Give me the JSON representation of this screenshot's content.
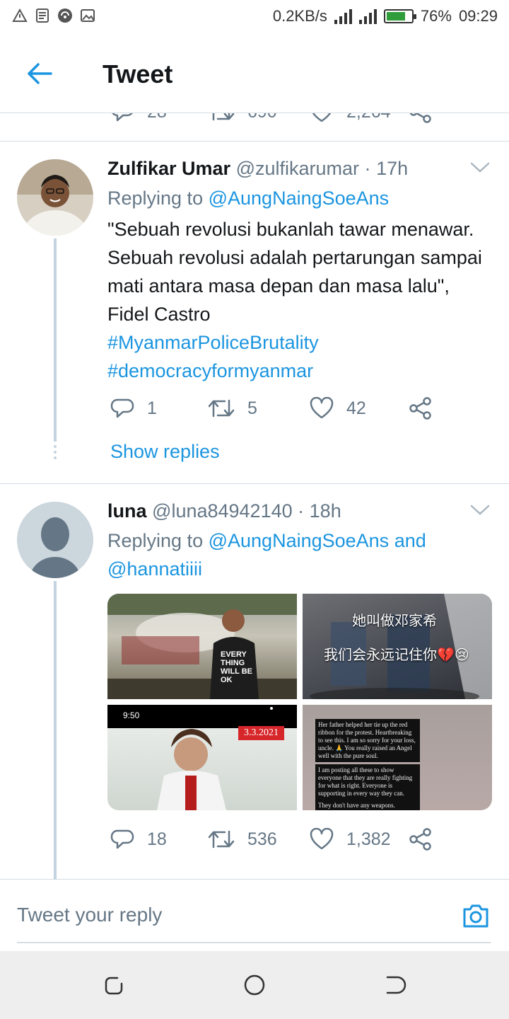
{
  "status_bar": {
    "net_speed": "0.2KB/s",
    "battery": "76%",
    "battery_level": 0.76,
    "time": "09:29"
  },
  "header": {
    "title": "Tweet"
  },
  "previous_tweet_actions": {
    "replies": "28",
    "retweets": "690",
    "likes": "2,264"
  },
  "tweets": [
    {
      "name": "Zulfikar Umar",
      "handle": "@zulfikarumar",
      "dot": "·",
      "time": "17h",
      "replying_prefix": "Replying to",
      "replying_to": "@AungNaingSoeAns",
      "text": "\"Sebuah revolusi bukanlah tawar menawar. Sebuah revolusi adalah pertarungan sampai mati antara masa depan dan masa lalu\", Fidel Castro",
      "hashtags": [
        "#MyanmarPoliceBrutality",
        "#democracyformyanmar"
      ],
      "replies": "1",
      "retweets": "5",
      "likes": "42",
      "show_replies": "Show replies"
    },
    {
      "name": "luna",
      "handle": "@luna84942140",
      "dot": "·",
      "time": "18h",
      "replying_prefix": "Replying to",
      "replying_to": "@AungNaingSoeAns and @hannatiiii",
      "media": [
        {
          "caption_line1": "EVERY THING WILL BE OK"
        },
        {
          "caption_line1": "她叫做邓家希",
          "caption_line2": "我们会永远记住你💔😢"
        },
        {
          "time": "9:50",
          "date": "3.3.2021"
        },
        {
          "box1": "Her father helped her tie up the red ribbon for the protest. Heartbreaking to see this. I am so sorry for your loss, uncle. 🙏 You really raised an Angel well with the pure soul.",
          "box2": "I am posting all these to show everyone that they are really fighting for what is right. Everyone is supporting in every way they can.",
          "box3": "They don't have any weapons."
        }
      ],
      "replies": "18",
      "retweets": "536",
      "likes": "1,382"
    }
  ],
  "composer": {
    "placeholder": "Tweet your reply"
  },
  "colors": {
    "accent": "#1b95e0",
    "secondary_text": "#657786",
    "divider": "#d6dde3"
  }
}
